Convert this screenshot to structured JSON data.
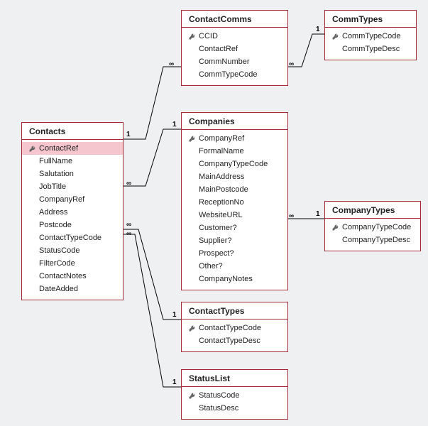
{
  "tables": {
    "contacts": {
      "title": "Contacts",
      "fields": [
        {
          "name": "ContactRef",
          "pk": true,
          "sel": true
        },
        {
          "name": "FullName"
        },
        {
          "name": "Salutation"
        },
        {
          "name": "JobTitle"
        },
        {
          "name": "CompanyRef"
        },
        {
          "name": "Address"
        },
        {
          "name": "Postcode"
        },
        {
          "name": "ContactTypeCode"
        },
        {
          "name": "StatusCode"
        },
        {
          "name": "FilterCode"
        },
        {
          "name": "ContactNotes"
        },
        {
          "name": "DateAdded"
        }
      ]
    },
    "contactcomms": {
      "title": "ContactComms",
      "fields": [
        {
          "name": "CCID",
          "pk": true
        },
        {
          "name": "ContactRef"
        },
        {
          "name": "CommNumber"
        },
        {
          "name": "CommTypeCode"
        }
      ]
    },
    "commtypes": {
      "title": "CommTypes",
      "fields": [
        {
          "name": "CommTypeCode",
          "pk": true
        },
        {
          "name": "CommTypeDesc"
        }
      ]
    },
    "companies": {
      "title": "Companies",
      "fields": [
        {
          "name": "CompanyRef",
          "pk": true
        },
        {
          "name": "FormalName"
        },
        {
          "name": "CompanyTypeCode"
        },
        {
          "name": "MainAddress"
        },
        {
          "name": "MainPostcode"
        },
        {
          "name": "ReceptionNo"
        },
        {
          "name": "WebsiteURL"
        },
        {
          "name": "Customer?"
        },
        {
          "name": "Supplier?"
        },
        {
          "name": "Prospect?"
        },
        {
          "name": "Other?"
        },
        {
          "name": "CompanyNotes"
        }
      ]
    },
    "companytypes": {
      "title": "CompanyTypes",
      "fields": [
        {
          "name": "CompanyTypeCode",
          "pk": true
        },
        {
          "name": "CompanyTypeDesc"
        }
      ]
    },
    "contacttypes": {
      "title": "ContactTypes",
      "fields": [
        {
          "name": "ContactTypeCode",
          "pk": true
        },
        {
          "name": "ContactTypeDesc"
        }
      ]
    },
    "statuslist": {
      "title": "StatusList",
      "fields": [
        {
          "name": "StatusCode",
          "pk": true
        },
        {
          "name": "StatusDesc"
        }
      ]
    }
  },
  "relationships": [
    {
      "from": "contacts",
      "to": "contactcomms",
      "from_card": "1",
      "to_card": "∞"
    },
    {
      "from": "contactcomms",
      "to": "commtypes",
      "from_card": "∞",
      "to_card": "1"
    },
    {
      "from": "contacts",
      "to": "companies",
      "from_card": "∞",
      "to_card": "1"
    },
    {
      "from": "companies",
      "to": "companytypes",
      "from_card": "∞",
      "to_card": "1"
    },
    {
      "from": "contacts",
      "to": "contacttypes",
      "from_card": "∞",
      "to_card": "1"
    },
    {
      "from": "contacts",
      "to": "statuslist",
      "from_card": "∞",
      "to_card": "1"
    }
  ],
  "card_labels": {
    "l1": "1",
    "l2": "∞",
    "l3": "1",
    "l4": "∞",
    "l5": "1",
    "l6": "∞",
    "l7": "1",
    "l8": "∞",
    "l9": "1",
    "l10": "∞",
    "l11": "1",
    "l12": "∞",
    "l13": "1"
  }
}
